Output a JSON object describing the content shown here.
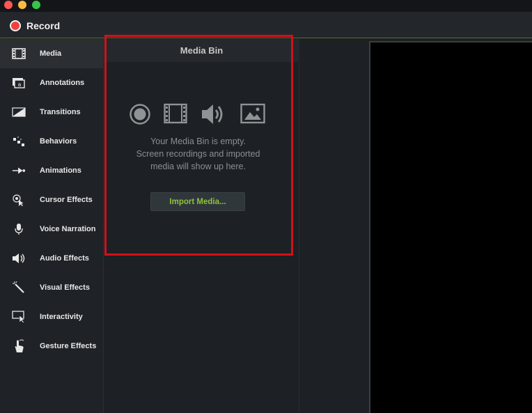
{
  "toolbar": {
    "record_label": "Record"
  },
  "sidebar": {
    "items": [
      {
        "label": "Media",
        "icon": "film-icon",
        "active": true
      },
      {
        "label": "Annotations",
        "icon": "annotation-icon"
      },
      {
        "label": "Transitions",
        "icon": "transition-icon"
      },
      {
        "label": "Behaviors",
        "icon": "behaviors-icon"
      },
      {
        "label": "Animations",
        "icon": "animation-arrow-icon"
      },
      {
        "label": "Cursor Effects",
        "icon": "cursor-effects-icon"
      },
      {
        "label": "Voice Narration",
        "icon": "microphone-icon"
      },
      {
        "label": "Audio Effects",
        "icon": "speaker-icon"
      },
      {
        "label": "Visual Effects",
        "icon": "magic-wand-icon"
      },
      {
        "label": "Interactivity",
        "icon": "interactivity-icon"
      },
      {
        "label": "Gesture Effects",
        "icon": "hand-gesture-icon"
      }
    ]
  },
  "media_bin": {
    "title": "Media Bin",
    "empty_line1": "Your Media Bin is empty.",
    "empty_line2": "Screen recordings and imported",
    "empty_line3": "media will show up here.",
    "import_label": "Import Media..."
  },
  "colors": {
    "accent_green": "#8fc23a",
    "record_red": "#f2413d",
    "highlight_red": "#d1111a"
  }
}
